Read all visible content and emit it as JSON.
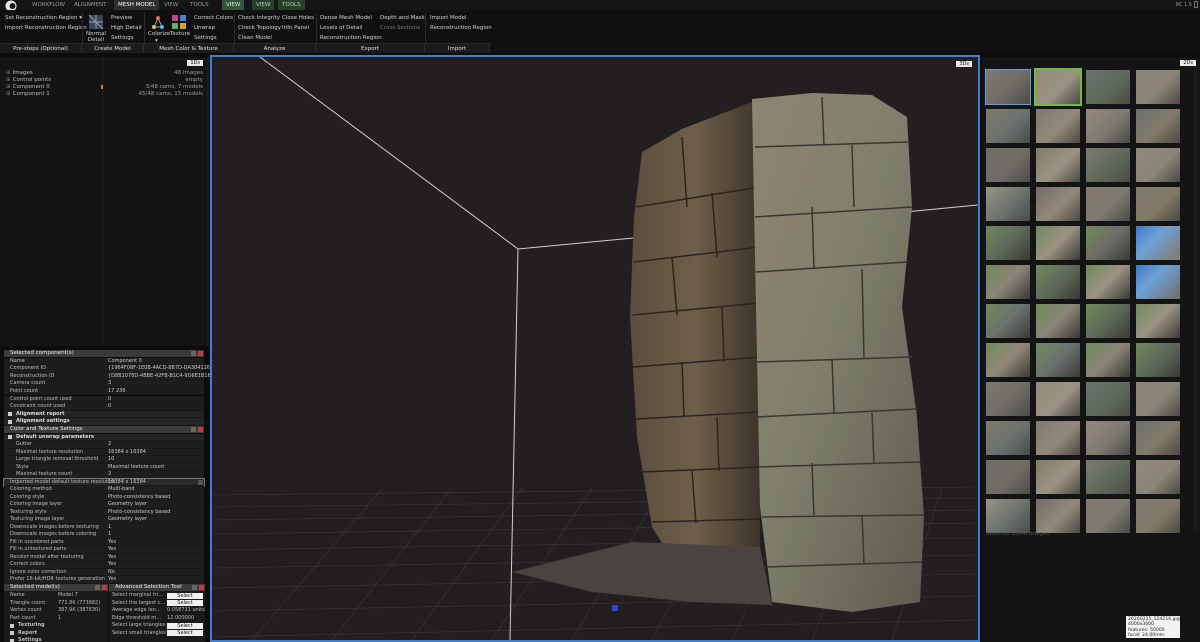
{
  "tabs": [
    "WORKFLOW",
    "ALIGNMENT",
    "MESH MODEL",
    "VIEW",
    "TOOLS",
    "VIEW",
    "VIEW",
    "TOOLS"
  ],
  "version": "RC 1.5",
  "ribbon": {
    "set_recon_region": "Set Reconstruction Region",
    "import_recon_region": "Import Reconstruction Region",
    "normal_detail": "Normal\nDetail",
    "preview": "Preview",
    "high_detail": "High Detail",
    "settings": "Settings",
    "colorize": "Colorize",
    "texture": "Texture",
    "correct_colors": "Correct Colors",
    "unwrap": "Unwrap",
    "settings2": "Settings",
    "check_integrity": "Check Integrity",
    "check_topology": "Check Topology",
    "clean_model": "Clean Model",
    "close_holes": "Close Holes",
    "info_panel": "Info Panel",
    "dense_mesh_model": "Dense Mesh Model",
    "levels_of_detail": "Levels of Detail",
    "reconstruction_region": "Reconstruction Region",
    "depth_and_mask": "Depth and Mask",
    "cross_sections": "Cross Sections",
    "import_model": "Import Model",
    "reconstruction_region2": "Reconstruction Region",
    "groups": [
      "Pre-steps (Optional)",
      "Create Model",
      "Mesh Color & Texture",
      "Analyze",
      "Export",
      "Import"
    ]
  },
  "tree": {
    "badge": "1Ds",
    "rows": [
      {
        "label": "Images",
        "value": "48 images"
      },
      {
        "label": "Control points",
        "value": "empty"
      },
      {
        "label": "Component 0",
        "value": "3/48 cams, 7 models"
      },
      {
        "label": "Component 1",
        "value": "45/48 cams, 15 models"
      }
    ]
  },
  "selected_component": {
    "title": "Selected component(s)",
    "rows": [
      {
        "k": "Name",
        "v": "Component 0"
      },
      {
        "k": "Component ID",
        "v": "{1964F08F-1E0B-4ACD-8B7D-DA304126..."
      },
      {
        "k": "Reconstruction ID",
        "v": "{D8B1078D-4BBE-42FB-B1C4-9D6E1B165..."
      },
      {
        "k": "Camera count",
        "v": "3"
      },
      {
        "k": "Point count",
        "v": "17 236"
      },
      {
        "k": "Control point count used",
        "v": "0"
      },
      {
        "k": "Constraint count used",
        "v": "0"
      }
    ],
    "sections": [
      "Alignment report",
      "Alignment settings"
    ]
  },
  "color_texture": {
    "title": "Color and Texture Settings",
    "section": "Default unwrap parameters",
    "rows": [
      {
        "k": "Gutter",
        "v": "2",
        "sub": true
      },
      {
        "k": "Maximal texture resolution",
        "v": "16384 x 16384",
        "sub": true
      },
      {
        "k": "Large triangle removal threshold",
        "v": "10",
        "sub": true
      },
      {
        "k": "Style",
        "v": "Maximal texture count",
        "sub": true
      },
      {
        "k": "Maximal texture count",
        "v": "2",
        "sub": true
      },
      {
        "k": "Imported-model default texture resolution",
        "v": "16384 x 16384",
        "hl": true
      },
      {
        "k": "Coloring method",
        "v": "Multi-band"
      },
      {
        "k": "Coloring style",
        "v": "Photo-consistency based"
      },
      {
        "k": "Coloring image layer",
        "v": "Geometry layer"
      },
      {
        "k": "Texturing style",
        "v": "Photo-consistency based"
      },
      {
        "k": "Texturing image layer",
        "v": "Geometry layer"
      },
      {
        "k": "Downscale images before texturing",
        "v": "1"
      },
      {
        "k": "Downscale images before coloring",
        "v": "1"
      },
      {
        "k": "Fill in uncolored parts",
        "v": "Yes"
      },
      {
        "k": "Fill in untextured parts",
        "v": "Yes"
      },
      {
        "k": "Recolor model after texturing",
        "v": "Yes"
      },
      {
        "k": "Correct colors",
        "v": "Yes"
      },
      {
        "k": "Ignore color correction",
        "v": "No"
      },
      {
        "k": "Prefer 16-bit/HDR textures generation",
        "v": "Yes"
      }
    ]
  },
  "selected_model": {
    "title": "Selected model(s)",
    "rows": [
      {
        "k": "Name",
        "v": "Model 7"
      },
      {
        "k": "Triangle count",
        "v": "771.8K (773982)"
      },
      {
        "k": "Vertex count",
        "v": "387.9K (387830)"
      },
      {
        "k": "Part count",
        "v": "1"
      }
    ],
    "sections": [
      "Texturing",
      "Report",
      "Settings"
    ]
  },
  "selection_tool": {
    "title": "Advanced Selection Tool",
    "rows": [
      {
        "k": "Select marginal tri...",
        "v": "Select"
      },
      {
        "k": "Select the largest c...",
        "v": "Select"
      },
      {
        "k": "Average edge len...",
        "v": "0.058731 units"
      },
      {
        "k": "Edge threshold m...",
        "v": "12.000000"
      },
      {
        "k": "Select large triangles",
        "v": "Select"
      },
      {
        "k": "Select small triangles",
        "v": "Select"
      }
    ]
  },
  "viewport": {
    "badge": "3Ds"
  },
  "images": {
    "badge": "2Ds",
    "status": "Selected 18/48 images",
    "info": [
      "20200225_124216.jpg",
      "4000x3000",
      "features: 50000",
      "focal: 24.00mm"
    ]
  }
}
